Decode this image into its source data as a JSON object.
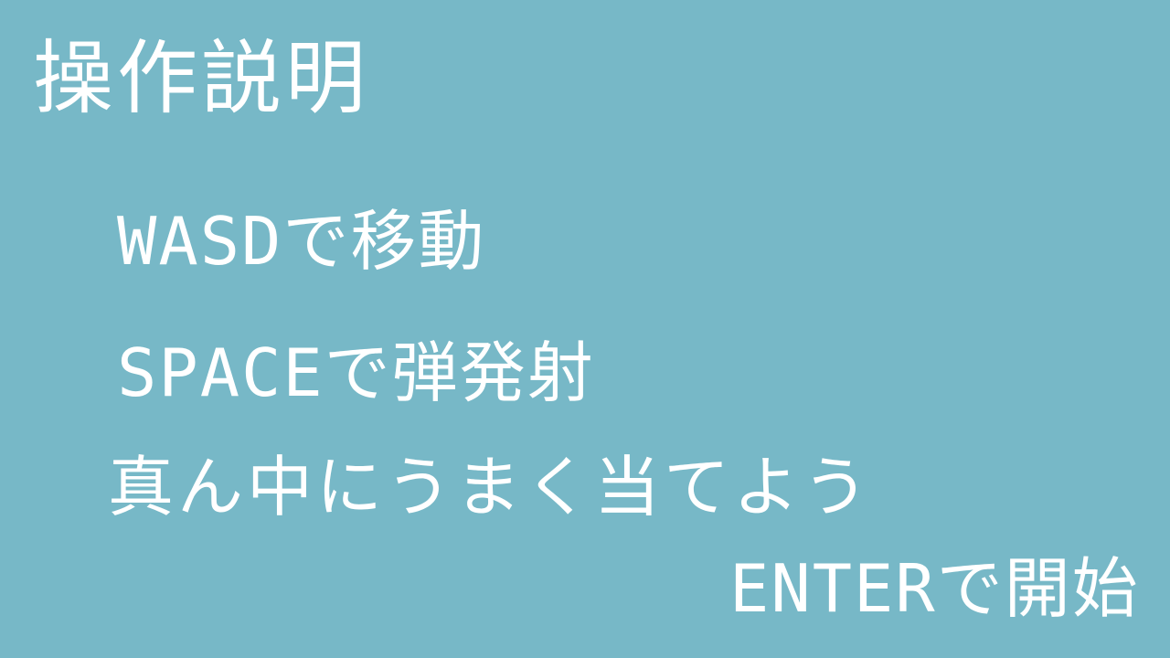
{
  "screen": {
    "background_color": "#77b8c7",
    "text_color": "#ffffff",
    "title": "操作説明",
    "instructions": [
      "WASDで移動",
      "SPACEで弾発射",
      "真ん中にうまく当てよう"
    ],
    "start_prompt": "ENTERで開始"
  }
}
